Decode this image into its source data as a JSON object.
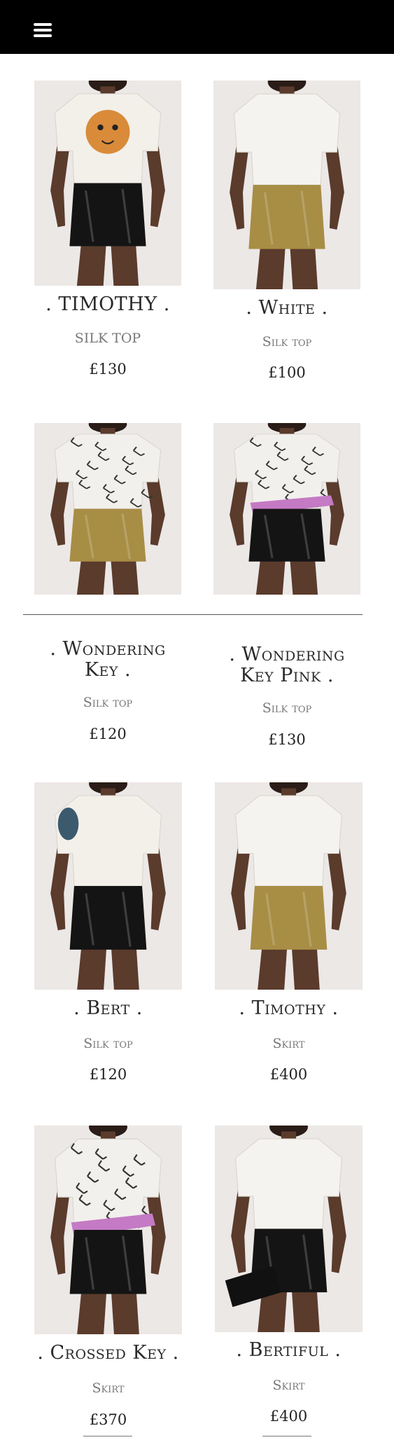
{
  "header": {
    "background": "#000000",
    "menu_icon": "hamburger-menu-icon"
  },
  "products": [
    {
      "id": "timothy-top",
      "title": ". TIMOTHY .",
      "type": "SILK TOP",
      "price": "£130",
      "top_color": "#f3f0ea",
      "bottom_color": "#141414",
      "print": "tiger"
    },
    {
      "id": "white-top",
      "title": ". White .",
      "type": "Silk top",
      "price": "£100",
      "top_color": "#f5f3ef",
      "bottom_color": "#a88d45",
      "print": "none"
    },
    {
      "id": "wondering-key-top",
      "title": ". Wondering Key .",
      "type": "Silk top",
      "price": "£120",
      "top_color": "#f2f0ec",
      "bottom_color": "#a88d45",
      "print": "keys"
    },
    {
      "id": "wondering-key-pink-top",
      "title": ". Wondering Key Pink .",
      "type": "Silk top",
      "price": "£130",
      "top_color": "#f2f0ec",
      "bottom_color": "#141414",
      "print": "keys-pink"
    },
    {
      "id": "bert-top",
      "title": ". Bert .",
      "type": "Silk top",
      "price": "£120",
      "top_color": "#f3f0ea",
      "bottom_color": "#141414",
      "print": "beetle"
    },
    {
      "id": "timothy-skirt",
      "title": ". Timothy .",
      "type": "Skirt",
      "price": "£400",
      "top_color": "#f5f3ef",
      "bottom_color": "#a88d45",
      "print": "none"
    },
    {
      "id": "crossed-key-skirt",
      "title": ". Crossed Key .",
      "type": "Skirt",
      "price": "£370",
      "top_color": "#f2f0ec",
      "bottom_color": "#141414",
      "print": "keys-pink"
    },
    {
      "id": "bertiful-skirt",
      "title": ". Bertiful .",
      "type": "Skirt",
      "price": "£400",
      "top_color": "#f5f3ef",
      "bottom_color": "#141414",
      "print": "clutch"
    }
  ]
}
